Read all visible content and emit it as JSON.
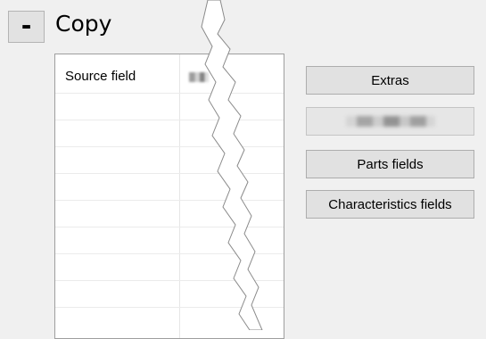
{
  "section": {
    "toggle_label": "-",
    "title": "Copy"
  },
  "grid": {
    "header_label": "Source field",
    "header_value": "[redacted]"
  },
  "buttons": {
    "extras_label": "Extras",
    "redacted_label": "[redacted]",
    "parts_fields_label": "Parts fields",
    "characteristics_fields_label": "Characteristics fields"
  }
}
